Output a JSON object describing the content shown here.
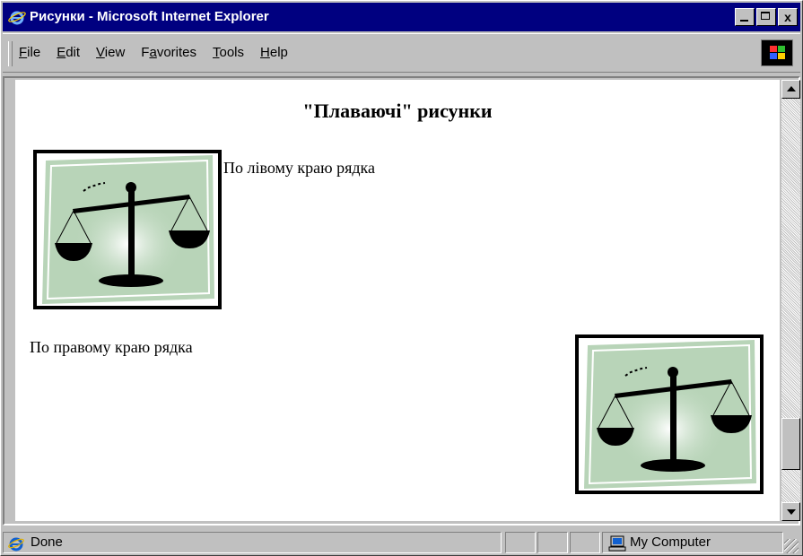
{
  "window": {
    "title": "Рисунки - Microsoft Internet Explorer",
    "close_label": "x"
  },
  "menu": {
    "items": [
      {
        "label": "File",
        "key": "F",
        "rest": "ile"
      },
      {
        "label": "Edit",
        "key": "E",
        "rest": "dit"
      },
      {
        "label": "View",
        "key": "V",
        "rest": "iew"
      },
      {
        "label": "Favorites",
        "pre": "F",
        "key": "a",
        "rest": "vorites"
      },
      {
        "label": "Tools",
        "key": "T",
        "rest": "ools"
      },
      {
        "label": "Help",
        "key": "H",
        "rest": "elp"
      }
    ]
  },
  "page": {
    "heading": "\"Плаваючі\" рисунки",
    "left_caption": "По лівому краю рядка",
    "right_caption": "По правому краю рядка",
    "image_icon": "scales-of-justice-icon"
  },
  "status": {
    "text": "Done",
    "zone": "My Computer"
  },
  "colors": {
    "title_bar": "#000080",
    "chrome": "#c0c0c0",
    "image_bg": "#b8d4b8"
  }
}
